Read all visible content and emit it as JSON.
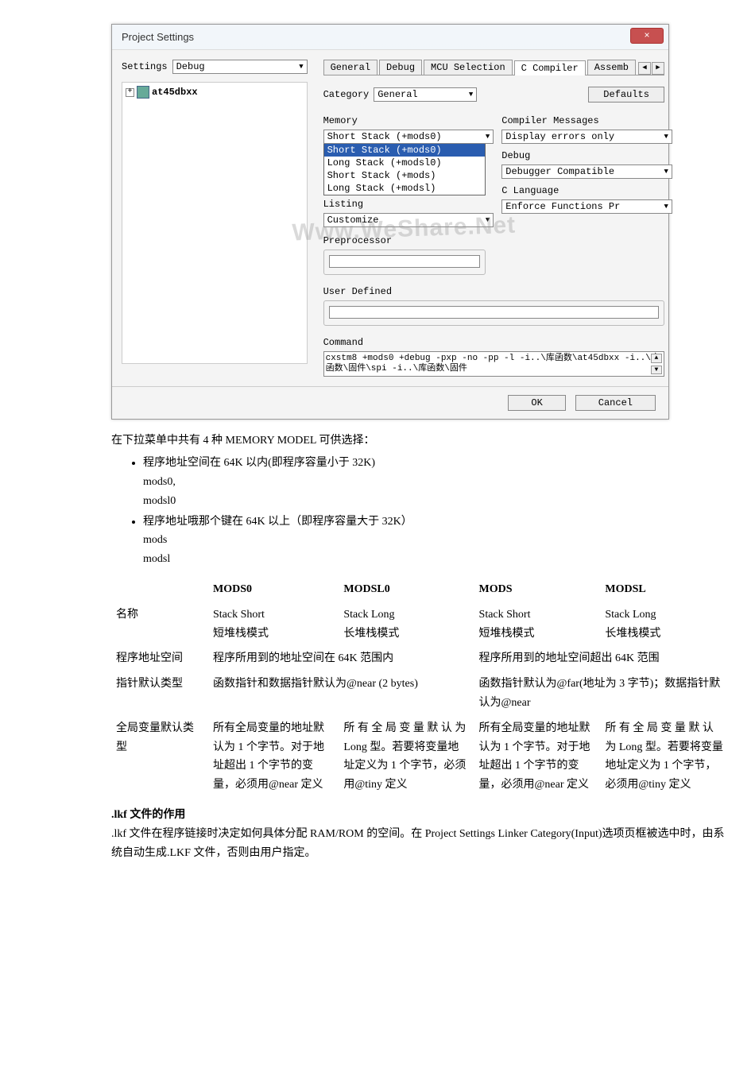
{
  "dialog": {
    "title": "Project Settings",
    "close": "×",
    "settings_label": "Settings",
    "settings_value": "Debug",
    "tree_item": "at45dbxx",
    "tabs": [
      "General",
      "Debug",
      "MCU Selection",
      "C Compiler",
      "Assemb"
    ],
    "category_label": "Category",
    "category_value": "General",
    "defaults_btn": "Defaults",
    "memory_label": "Memory",
    "memory_value": "Short Stack (+mods0)",
    "memory_options": [
      "Short Stack (+mods0)",
      "Long Stack (+modsl0)",
      "Short Stack (+mods)",
      "Long Stack (+modsl)"
    ],
    "listing_label": "Listing",
    "listing_value": "Customize",
    "preprocessor_label": "Preprocessor",
    "user_defined_label": "User Defined",
    "command_label": "Command",
    "command_text": "cxstm8 +mods0 +debug -pxp -no -pp -l -i..\\库函数\\at45dbxx -i..\\库函数\\固件\\spi -i..\\库函数\\固件",
    "compiler_msgs_label": "Compiler Messages",
    "compiler_msgs_value": "Display errors only",
    "debug_label": "Debug",
    "debug_value": "Debugger Compatible",
    "clang_label": "C Language",
    "clang_value": "Enforce Functions Pr",
    "ok": "OK",
    "cancel": "Cancel",
    "watermark": "Www.WeShare.Net"
  },
  "text": {
    "intro": "在下拉菜单中共有 4 种 MEMORY MODEL 可供选择：",
    "b1_line1": "程序地址空间在 64K 以内(即程序容量小于 32K)",
    "b1_line2": "mods0,",
    "b1_line3": "modsl0",
    "b2_line1": "程序地址哦那个键在 64K 以上（即程序容量大于 32K）",
    "b2_line2": "mods",
    "b2_line3": "modsl",
    "table": {
      "headers": [
        "MODS0",
        "MODSL0",
        "MODS",
        "MODSL"
      ],
      "row_name_label": "名称",
      "row_name": [
        "Stack Short\n短堆栈模式",
        "Stack Long\n长堆栈模式",
        "Stack Short\n短堆栈模式",
        "Stack Long\n长堆栈模式"
      ],
      "row_addr_label": "程序地址空间",
      "row_addr_left": "程序所用到的地址空间在 64K 范围内",
      "row_addr_right": "程序所用到的地址空间超出 64K 范围",
      "row_ptr_label": "指针默认类型",
      "row_ptr_left": "函数指针和数据指针默认为@near (2 bytes)",
      "row_ptr_right": "函数指针默认为@far(地址为 3 字节)；数据指针默认为@near",
      "row_glob_label": "全局变量默认类型",
      "row_glob": [
        "所有全局变量的地址默认为 1 个字节。对于地址超出 1 个字节的变量，必须用@near 定义",
        "所 有 全 局 变 量 默 认 为 Long 型。若要将变量地址定义为 1 个字节，必须用@tiny 定义",
        "所有全局变量的地址默认为 1 个字节。对于地址超出 1 个字节的变量，必须用@near 定义",
        "所 有 全 局 变 量 默 认 为 Long 型。若要将变量地址定义为 1 个字节，必须用@tiny 定义"
      ]
    },
    "lkf_title": ".lkf  文件的作用",
    "lkf_body": ".lkf 文件在程序链接时决定如何具体分配 RAM/ROM 的空间。在 Project Settings   Linker   Category(Input)选项页框被选中时，由系统自动生成.LKF 文件，否则由用户指定。"
  }
}
